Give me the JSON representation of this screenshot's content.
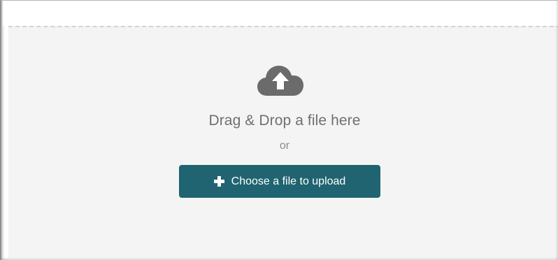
{
  "colors": {
    "accent": "#1f6470",
    "drop_zone_bg": "#f4f4f4",
    "icon": "#6b6b6b",
    "text": "#6f6f6f"
  },
  "drop_zone": {
    "icon": "cloud-upload-icon",
    "message": "Drag & Drop a file here",
    "separator": "or",
    "button": {
      "icon": "plus-icon",
      "label": "Choose a file to upload"
    }
  }
}
